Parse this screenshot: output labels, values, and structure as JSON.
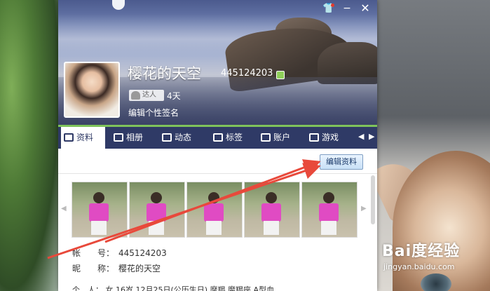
{
  "header": {
    "nickname": "樱花的天空",
    "qq_number": "445124203",
    "level_badge": "达人",
    "active_days": "4天",
    "signature": "编辑个性签名"
  },
  "window_buttons": {
    "minimize": "−",
    "close": "✕",
    "shirt": "👕"
  },
  "tabs": [
    {
      "label": "资料"
    },
    {
      "label": "相册"
    },
    {
      "label": "动态"
    },
    {
      "label": "标签"
    },
    {
      "label": "账户"
    },
    {
      "label": "游戏"
    }
  ],
  "tab_nav": {
    "prev": "◀",
    "next": "▶"
  },
  "content": {
    "edit_button": "编辑资料",
    "gallery_prev": "◀",
    "gallery_next": "▶",
    "fields": [
      {
        "key": "帐　　号：",
        "value": "445124203"
      },
      {
        "key": "昵　　称：",
        "value": "樱花的天空"
      }
    ],
    "partial_row": "个　人：  女  16岁   12月25日(公历生日)   摩羯   魔羯座   A型血"
  },
  "watermark": {
    "main": "Bai度经验",
    "sub": "jingyan.baidu.com"
  },
  "colors": {
    "tabbar": "#2f3a66",
    "accent_green": "#7fc35b",
    "arrow": "#e8493b"
  }
}
